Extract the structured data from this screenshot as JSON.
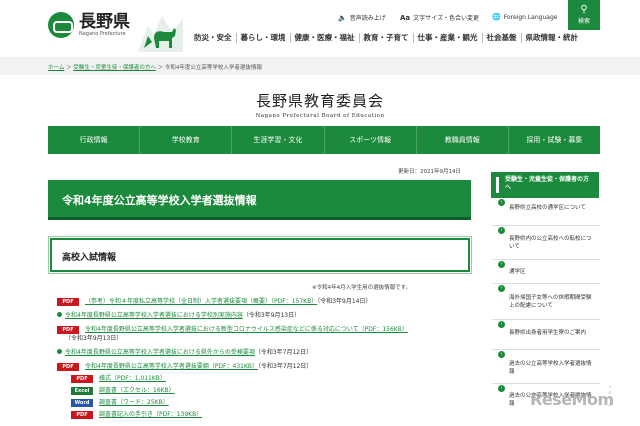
{
  "header": {
    "logo_ja": "長野県",
    "logo_en": "Nagano Prefecture",
    "util": {
      "voice": "音声読み上げ",
      "textsize": "文字サイズ・色合い変更",
      "language": "Foreign Language"
    },
    "search_label": "検索",
    "gnav": [
      "防災・安全",
      "暮らし・環境",
      "健康・医療・福祉",
      "教育・子育て",
      "仕事・産業・観光",
      "社会基盤",
      "県政情報・統計"
    ]
  },
  "breadcrumb": {
    "items": [
      "ホーム",
      "受験生・児童生徒・保護者の方へ"
    ],
    "current": "令和4年度公立高等学校入学者選抜情報"
  },
  "site": {
    "title_ja": "長野県教育委員会",
    "title_en": "Nagano Prefectural Board of Education"
  },
  "mainnav": [
    "行政情報",
    "学校教育",
    "生涯学習・文化",
    "スポーツ情報",
    "教職員情報",
    "採用・試験・募集"
  ],
  "content": {
    "updated": "更新日：2021年9月14日",
    "page_title": "令和4年度公立高等学校入学者選抜情報",
    "section_title": "高校入試情報",
    "note": "※令和4年4月入学生用の選抜情報です。",
    "items": [
      {
        "badge": "PDF",
        "link": "（参考）令和４年度私立高等学校（全日制）入学者選抜要項（概要）（PDF：157KB）",
        "tail": "（令和3年9月14日）"
      },
      {
        "link": "令和4年度長野県公立高等学校入学者選抜における学校別実施内容",
        "tail": "（令和3年9月13日）"
      },
      {
        "badge": "PDF",
        "link": "令和4年度長野県公立高等学校入学者選抜における新型コロナウイルス感染症などに係る対応について（PDF：156KB）",
        "tail2": "（令和3年9月13日）"
      },
      {
        "link": "令和4年度長野県公立高等学校入学者選抜における県外からの受検要項",
        "tail": "（令和3年7月12日）"
      },
      {
        "badge": "PDF",
        "link": "令和4年度長野県公立高等学校入学者選抜要綱（PDF：431KB）",
        "tail": "（令和3年7月12日）"
      },
      {
        "badge": "PDF",
        "link": "様式（PDF：1,011KB）"
      },
      {
        "badge": "Excel",
        "link": "調査書（エクセル：16KB）"
      },
      {
        "badge": "Word",
        "link": "調査書（ワード：25KB）"
      },
      {
        "badge": "PDF",
        "link": "調査書記入の手引き（PDF：139KB）"
      }
    ]
  },
  "sidebar": {
    "head": "受験生・児童生徒・保護者の方へ",
    "items": [
      "長野県立高校の通学区について",
      "長野県内の公立高校への転校について",
      "通学区",
      "海外帰国子女等への休暇期間受験上の配慮について",
      "長野県出身者用学生寮のご案内",
      "過去の公立高等学校入学者選抜情報",
      "過去の公立高等学校入学者選抜情報"
    ]
  },
  "watermark": {
    "text": "ReseMom",
    "sub": "リセマム"
  },
  "colors": {
    "brand_green": "#1b8a3c",
    "pdf_red": "#c8171d",
    "excel_green": "#1d7a3a",
    "word_blue": "#2457a8"
  }
}
